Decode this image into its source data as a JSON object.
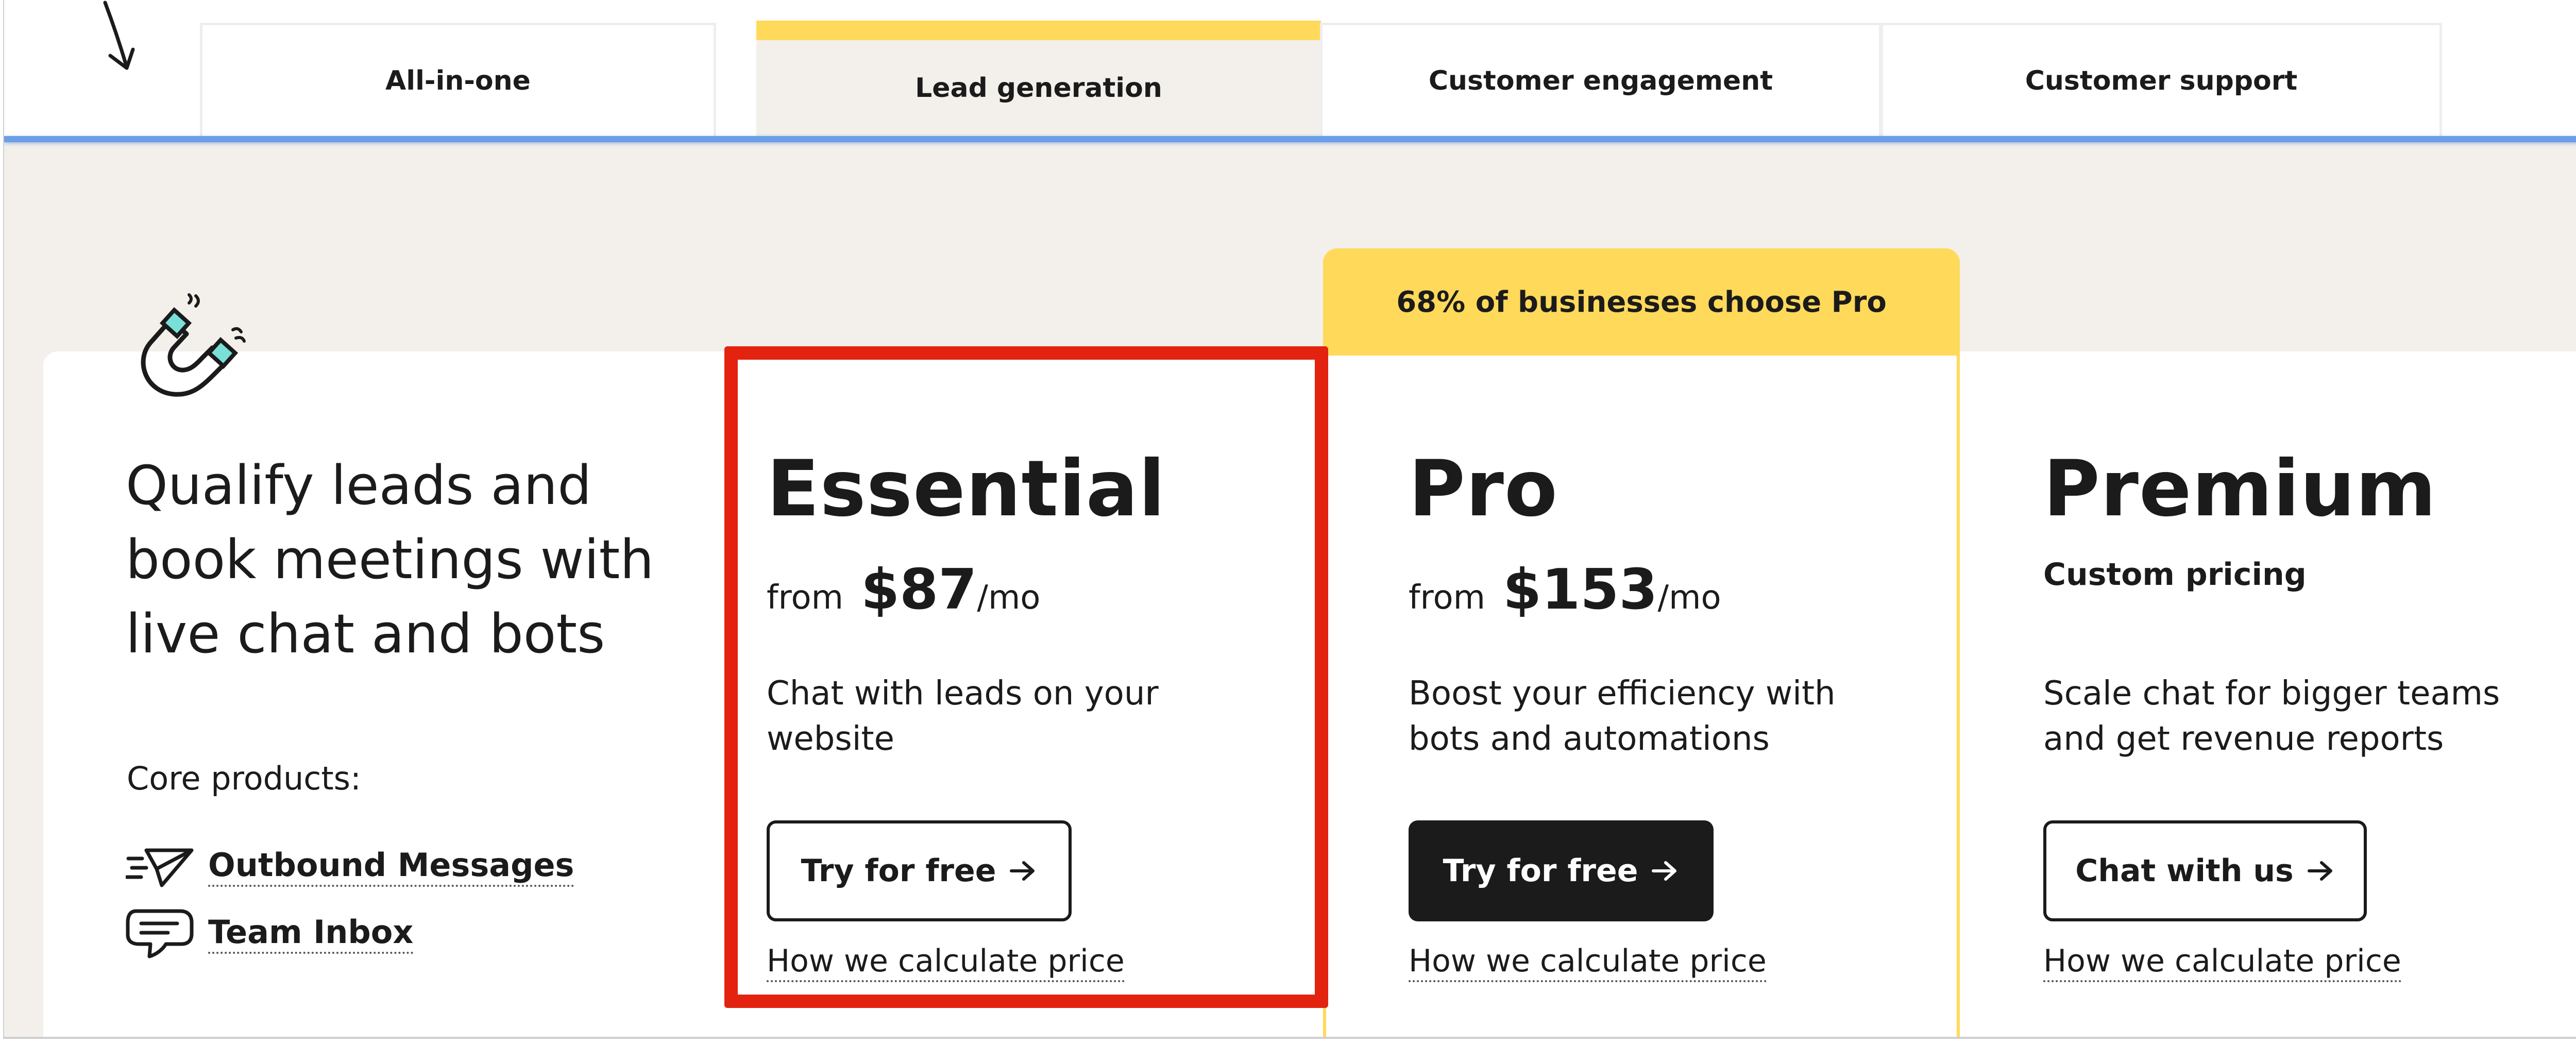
{
  "tabs": [
    {
      "label": "All-in-one",
      "active": false
    },
    {
      "label": "Lead generation",
      "active": true
    },
    {
      "label": "Customer engagement",
      "active": false
    },
    {
      "label": "Customer support",
      "active": false
    }
  ],
  "intro": {
    "headline": "Qualify leads and book meetings with live chat and bots",
    "core_label": "Core products:",
    "products": [
      {
        "label": "Outbound Messages",
        "icon": "paper-plane-icon"
      },
      {
        "label": "Team Inbox",
        "icon": "chat-bubble-icon"
      }
    ]
  },
  "pro_banner": "68% of businesses choose Pro",
  "plans": [
    {
      "name": "Essential",
      "from": "from",
      "price": "$87",
      "per": "/mo",
      "description": "Chat with leads on your website",
      "button": "Try for free",
      "link": "How we calculate price"
    },
    {
      "name": "Pro",
      "from": "from",
      "price": "$153",
      "per": "/mo",
      "description": "Boost your efficiency with bots and automations",
      "button": "Try for free",
      "link": "How we calculate price"
    },
    {
      "name": "Premium",
      "custom_pricing": "Custom pricing",
      "description": "Scale chat for bigger teams and get revenue reports",
      "button": "Chat with us",
      "link": "How we calculate price"
    }
  ],
  "colors": {
    "accent_yellow": "#ffd95a",
    "annotation_red": "#e3230f",
    "tab_underline_blue": "#6b9ee6",
    "page_background": "#f3f0ec",
    "text_dark": "#1b1b1b"
  }
}
